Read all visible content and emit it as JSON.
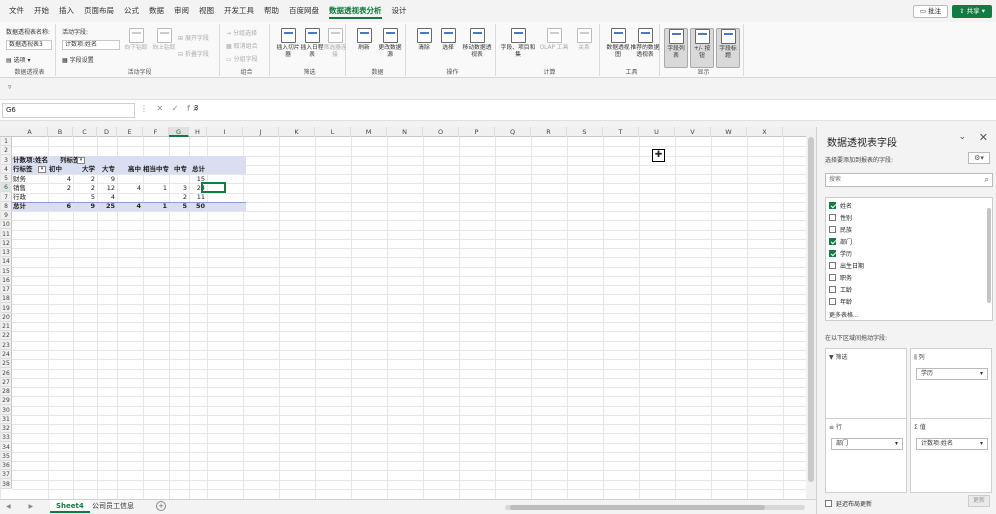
{
  "menu": {
    "tabs": [
      "文件",
      "开始",
      "插入",
      "页面布局",
      "公式",
      "数据",
      "审阅",
      "视图",
      "开发工具",
      "帮助",
      "百度网盘",
      "数据透视表分析",
      "设计"
    ],
    "active": "数据透视表分析",
    "comment_label": "批注",
    "share_label": "共享"
  },
  "ribbon": {
    "pivot_name_label": "数据透视表名称:",
    "pivot_name_value": "数据透视表3",
    "options_label": "选项",
    "group1_label": "数据透视表",
    "active_field_label": "活动字段:",
    "active_field_value": "计数项:姓名",
    "field_settings_label": "字段设置",
    "drill_down": "向下钻取",
    "drill_up": "向上钻取",
    "expand_field": "展开字段",
    "collapse_field": "折叠字段",
    "group2_label": "活动字段",
    "group_selection": "分组选择",
    "ungroup": "取消组合",
    "group_field": "分组字段",
    "group3_label": "组合",
    "insert_slicer": "插入切片器",
    "insert_timeline": "插入日程表",
    "filter_connections": "筛选器连接",
    "group4_label": "筛选",
    "refresh": "刷新",
    "change_source": "更改数据源",
    "group5_label": "数据",
    "clear": "清除",
    "select": "选择",
    "move_pivot": "移动数据透视表",
    "group6_label": "操作",
    "fields_items": "字段、项目和集",
    "olap": "OLAP 工具",
    "relationships": "关系",
    "group7_label": "计算",
    "pivot_chart": "数据透视图",
    "recommended": "推荐的数据透视表",
    "group8_label": "工具",
    "field_list": "字段列表",
    "buttons": "+/- 按钮",
    "field_headers": "字段标题",
    "group9_label": "显示"
  },
  "formula_bar": {
    "name_box": "G6",
    "icons": "⋮ ✕ ✓ fx",
    "content": "3"
  },
  "grid": {
    "columns": [
      "A",
      "B",
      "C",
      "D",
      "E",
      "F",
      "G",
      "H",
      "I",
      "J",
      "K",
      "L",
      "M",
      "N",
      "O",
      "P",
      "Q",
      "R",
      "S",
      "T",
      "U",
      "V",
      "W",
      "X"
    ],
    "rows": [
      "1",
      "2",
      "3",
      "4",
      "5",
      "6",
      "7",
      "8",
      "9",
      "10",
      "11",
      "12",
      "13",
      "14",
      "15",
      "16",
      "17",
      "18",
      "19",
      "20",
      "21",
      "22",
      "23",
      "24",
      "25",
      "26",
      "27",
      "28",
      "29",
      "30",
      "31",
      "32",
      "33",
      "34",
      "35",
      "36",
      "37",
      "38"
    ],
    "active_col": "G",
    "active_row": "6"
  },
  "pivot": {
    "corner": "计数项:姓名",
    "col_label": "列标签",
    "row_label": "行标签",
    "col_headers": [
      "初中",
      "大学",
      "大专",
      "高中",
      "相当中专",
      "中专",
      "总计"
    ],
    "rows": [
      {
        "label": "财务",
        "values": [
          "4",
          "2",
          "9",
          "",
          "",
          "",
          "15"
        ]
      },
      {
        "label": "销售",
        "values": [
          "2",
          "2",
          "12",
          "4",
          "1",
          "3",
          "24"
        ]
      },
      {
        "label": "行政",
        "values": [
          "",
          "5",
          "4",
          "",
          "",
          "2",
          "11"
        ]
      }
    ],
    "total": {
      "label": "总计",
      "values": [
        "6",
        "9",
        "25",
        "4",
        "1",
        "5",
        "50"
      ]
    }
  },
  "sheets": {
    "tabs": [
      "Sheet4",
      "公司员工信息"
    ],
    "active": "Sheet4",
    "nav": "◀ ▶",
    "add": "+"
  },
  "panel": {
    "title": "数据透视表字段",
    "subtitle": "选择要添加到报表的字段:",
    "search_placeholder": "搜索",
    "fields": [
      {
        "name": "姓名",
        "checked": true
      },
      {
        "name": "性别",
        "checked": false
      },
      {
        "name": "民族",
        "checked": false
      },
      {
        "name": "部门",
        "checked": true
      },
      {
        "name": "学历",
        "checked": true
      },
      {
        "name": "出生日期",
        "checked": false
      },
      {
        "name": "职务",
        "checked": false
      },
      {
        "name": "工龄",
        "checked": false
      },
      {
        "name": "年龄",
        "checked": false
      }
    ],
    "more_tables": "更多表格...",
    "drag_tip": "在以下区域间拖动字段:",
    "areas": {
      "filter": "筛选",
      "columns": "列",
      "rows": "行",
      "values": "值",
      "columns_field": "学历",
      "rows_field": "部门",
      "values_field": "计数项:姓名"
    },
    "defer_label": "延迟布局更新",
    "update_label": "更新"
  }
}
